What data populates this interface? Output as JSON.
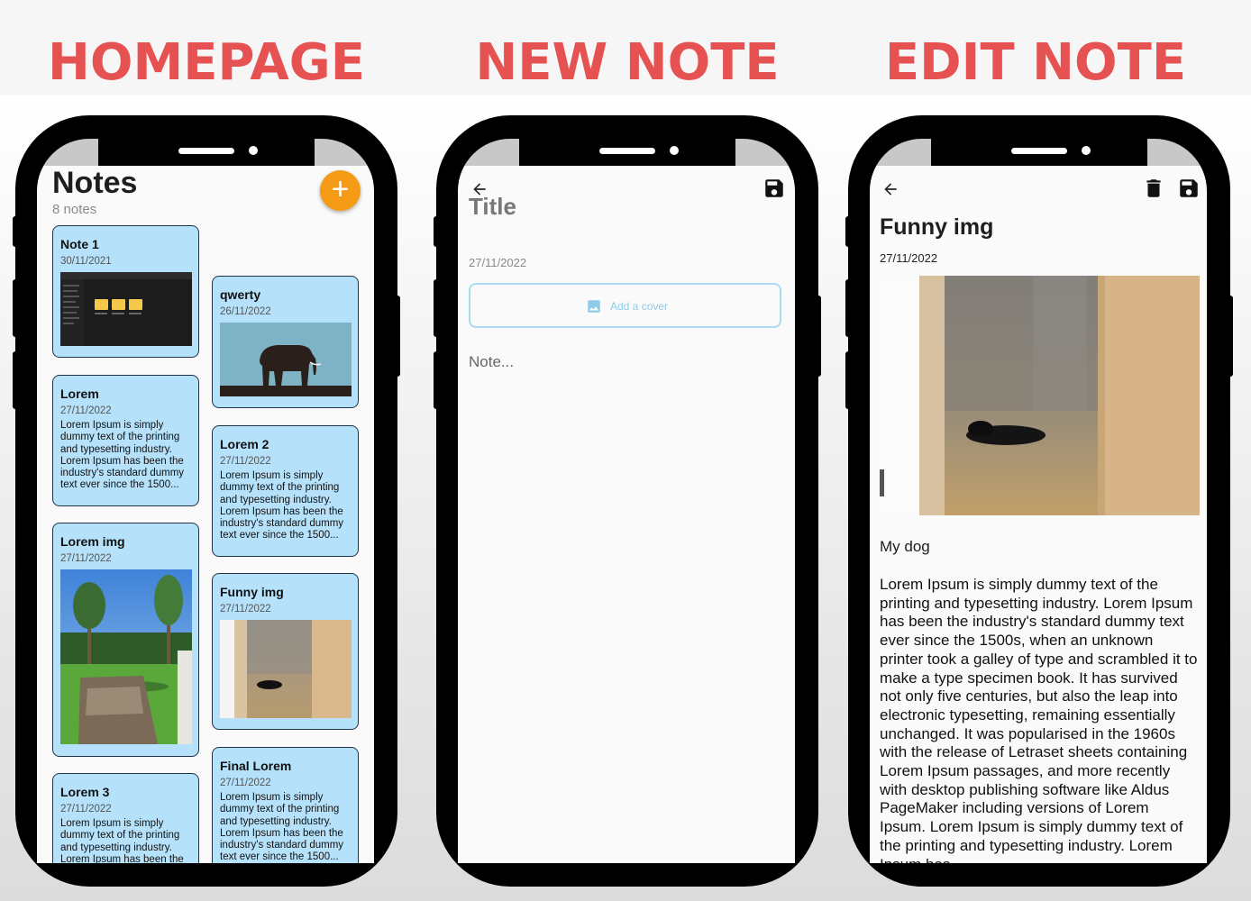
{
  "sections": {
    "homepage": "HOMEPAGE",
    "new_note": "NEW NOTE",
    "edit_note": "EDIT NOTE"
  },
  "homepage": {
    "title": "Notes",
    "count": "8 notes",
    "add_icon": "plus-icon",
    "left_column": [
      {
        "title": "Note 1",
        "date": "30/11/2021",
        "image": "file-explorer-screenshot"
      },
      {
        "title": "Lorem",
        "date": "27/11/2022",
        "text": "Lorem Ipsum is simply dummy text of the printing and typesetting industry. Lorem Ipsum has been the industry's standard dummy text ever since the 1500..."
      },
      {
        "title": "Lorem img",
        "date": "27/11/2022",
        "image": "garden-with-chair-photo"
      },
      {
        "title": "Lorem 3",
        "date": "27/11/2022",
        "text": "Lorem Ipsum is simply dummy text of the printing and typesetting industry. Lorem Ipsum has been the"
      }
    ],
    "right_column": [
      {
        "title": "qwerty",
        "date": "26/11/2022",
        "image": "elephant-silhouette"
      },
      {
        "title": "Lorem 2",
        "date": "27/11/2022",
        "text": "Lorem Ipsum is simply dummy text of the printing and typesetting industry. Lorem Ipsum has been the industry's standard dummy text ever since the 1500..."
      },
      {
        "title": "Funny img",
        "date": "27/11/2022",
        "image": "dog-behind-door-photo"
      },
      {
        "title": "Final Lorem",
        "date": "27/11/2022",
        "text": "Lorem Ipsum is simply dummy text of the printing and typesetting industry. Lorem Ipsum has been the industry's standard dummy text ever since the 1500..."
      }
    ]
  },
  "new_note": {
    "back_icon": "arrow-left-icon",
    "save_icon": "save-icon",
    "title_placeholder": "Title",
    "date": "27/11/2022",
    "cover_label": "Add a cover",
    "cover_icon": "image-icon",
    "note_placeholder": "Note..."
  },
  "edit_note": {
    "back_icon": "arrow-left-icon",
    "delete_icon": "trash-icon",
    "save_icon": "save-icon",
    "title": "Funny img",
    "date": "27/11/2022",
    "image": "dog-behind-door-photo",
    "subtitle": "My dog",
    "body": "Lorem Ipsum is simply dummy text of the printing and typesetting industry. Lorem Ipsum has been the industry's standard dummy text ever since the 1500s, when an unknown printer took a galley of type and scrambled it to make a type specimen book. It has survived not only five centuries, but also the leap into electronic typesetting, remaining essentially unchanged. It was popularised in the 1960s with the release of Letraset sheets containing Lorem Ipsum passages, and more recently with desktop publishing software like Aldus PageMaker including versions of Lorem Ipsum. Lorem Ipsum is simply dummy text of the printing and typesetting industry. Lorem Ipsum has"
  },
  "colors": {
    "headline": "#e65252",
    "card_background": "#b5e2fa",
    "fab": "#f59b16",
    "cover_border": "#a9dcf2"
  }
}
